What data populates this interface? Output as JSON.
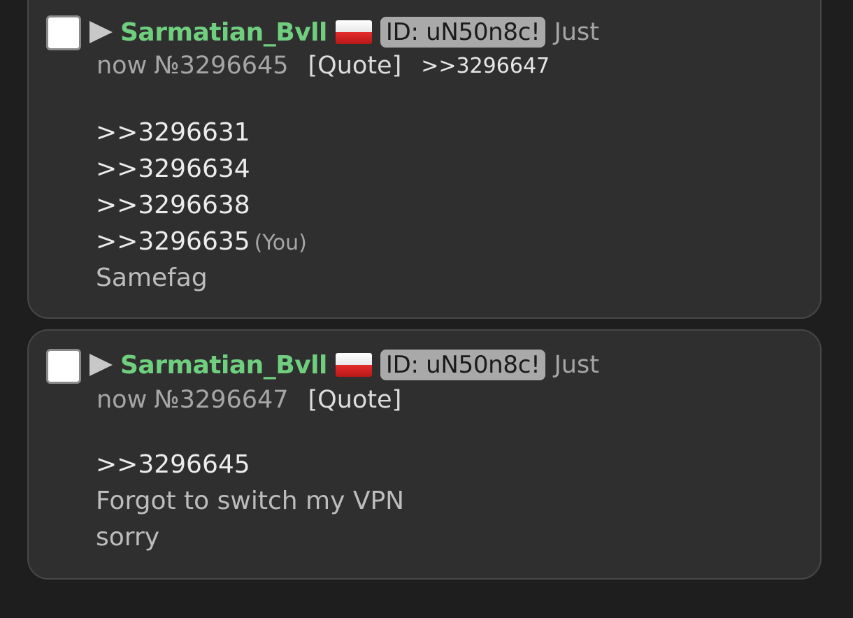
{
  "posts": [
    {
      "name": "Sarmatian_Bvll",
      "flag": "poland",
      "id_label": "ID: uN50n8c!",
      "time_part1": "Just",
      "time_part2": "now",
      "number": "№3296645",
      "quote_label": "[Quote]",
      "backlink": ">>3296647",
      "body": {
        "refs": [
          ">>3296631",
          ">>3296634",
          ">>3296638",
          ">>3296635"
        ],
        "you_marker": "(You)",
        "text": [
          "Samefag"
        ]
      }
    },
    {
      "name": "Sarmatian_Bvll",
      "flag": "poland",
      "id_label": "ID: uN50n8c!",
      "time_part1": "Just",
      "time_part2": "now",
      "number": "№3296647",
      "quote_label": "[Quote]",
      "body": {
        "refs": [
          ">>3296645"
        ],
        "text": [
          "Forgot to switch my VPN",
          "sorry"
        ]
      }
    }
  ],
  "colors": {
    "background": "#1e1e1e",
    "card": "#2f2f2f",
    "name": "#6fcf7f",
    "id_badge": "#a9a9a9"
  }
}
